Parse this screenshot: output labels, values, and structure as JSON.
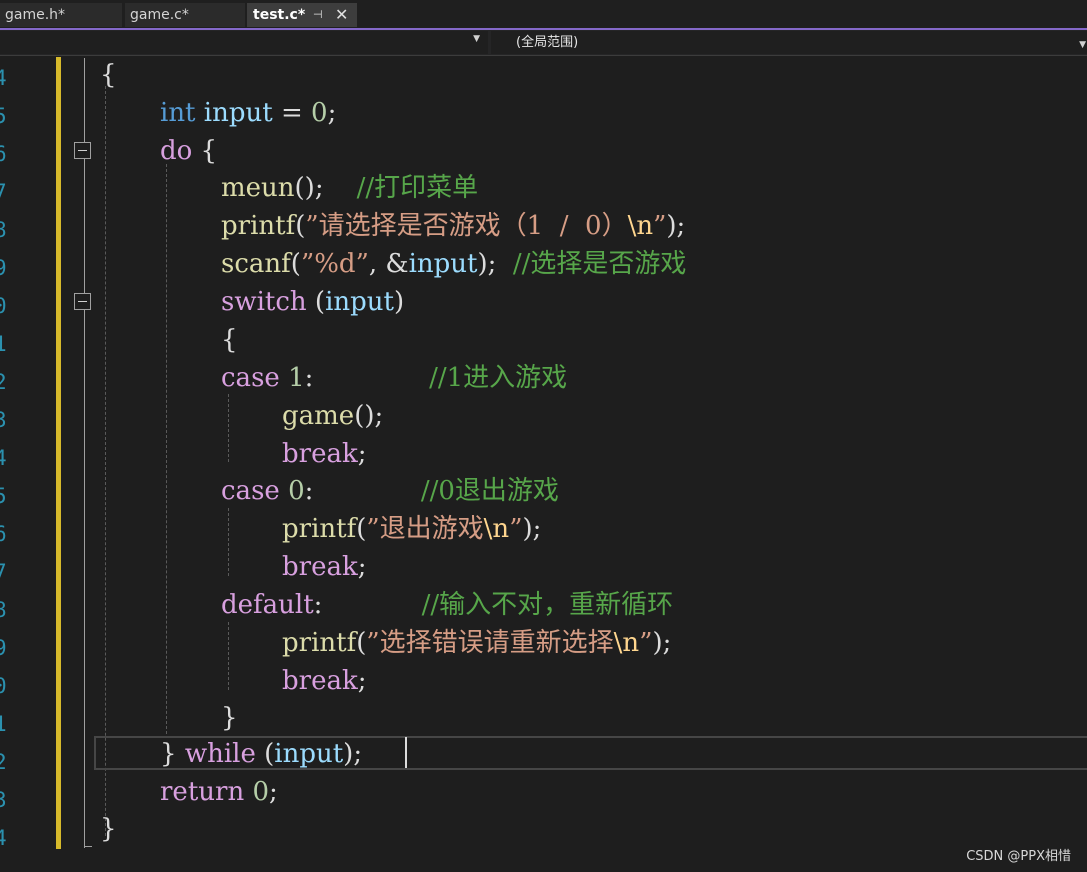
{
  "tabs": [
    {
      "label": "game.h*"
    },
    {
      "label": "game.c*"
    },
    {
      "label": "test.c*",
      "active": true
    }
  ],
  "tab_pin_icon": "pin-icon",
  "tab_close_icon": "close-icon",
  "navbar": {
    "left_value": "",
    "scope_value": "(全局范围)"
  },
  "gutter_numbers": [
    "4",
    "5",
    "6",
    "7",
    "8",
    "9",
    "0",
    "1",
    "2",
    "3",
    "4",
    "5",
    "6",
    "7",
    "8",
    "9",
    "0",
    "1",
    "2",
    "3",
    "4"
  ],
  "code": {
    "l1": "{",
    "l2_kw": "int",
    "l2_var": "input",
    "l2_rest": " = ",
    "l2_num": "0",
    "l2_end": ";",
    "l3_kw": "do",
    "l3_rest": " {",
    "l4_fn": "meun",
    "l4_rest": "();    ",
    "l4_cmt": "//打印菜单",
    "l5_fn": "printf",
    "l5_open": "(",
    "l5_str": "”请选择是否游戏（1  /  0）",
    "l5_esc": "\\n",
    "l5_strend": "”",
    "l5_end": ");",
    "l6_fn": "scanf",
    "l6_open": "(",
    "l6_str": "”%d”",
    "l6_mid": ", &",
    "l6_var": "input",
    "l6_end": ");  ",
    "l6_cmt": "//选择是否游戏",
    "l7_kw": "switch",
    "l7_rest": " (",
    "l7_var": "input",
    "l7_end": ")",
    "l8": "{",
    "l9_kw": "case",
    "l9_rest": " ",
    "l9_num": "1",
    "l9_end": ":              ",
    "l9_cmt": "//1进入游戏",
    "l10_fn": "game",
    "l10_end": "();",
    "l11_kw": "break",
    "l11_end": ";",
    "l12_kw": "case",
    "l12_rest": " ",
    "l12_num": "0",
    "l12_end": ":             ",
    "l12_cmt": "//0退出游戏",
    "l13_fn": "printf",
    "l13_open": "(",
    "l13_str": "”退出游戏",
    "l13_esc": "\\n",
    "l13_strend": "”",
    "l13_end": ");",
    "l14_kw": "break",
    "l14_end": ";",
    "l15_kw": "default",
    "l15_end": ":            ",
    "l15_cmt": "//输入不对，重新循环",
    "l16_fn": "printf",
    "l16_open": "(",
    "l16_str": "”选择错误请重新选择",
    "l16_esc": "\\n",
    "l16_strend": "”",
    "l16_end": ");",
    "l17_kw": "break",
    "l17_end": ";",
    "l18": "}",
    "l19_brace": "} ",
    "l19_kw": "while",
    "l19_rest": " (",
    "l19_var": "input",
    "l19_end": ");",
    "l20_kw": "return",
    "l20_rest": " ",
    "l20_num": "0",
    "l20_end": ";",
    "l21": "}"
  },
  "watermark": "CSDN @PPX相惜",
  "colors": {
    "keyword": "#569cd6",
    "control": "#d8a0df",
    "function": "#dcdcaa",
    "variable": "#9cdcfe",
    "string": "#d69d85",
    "comment": "#57a64a",
    "number": "#b5cea8",
    "accent_tab_border": "#8468c9",
    "change_bar": "#d7ba2b",
    "line_number": "#2b91af"
  }
}
